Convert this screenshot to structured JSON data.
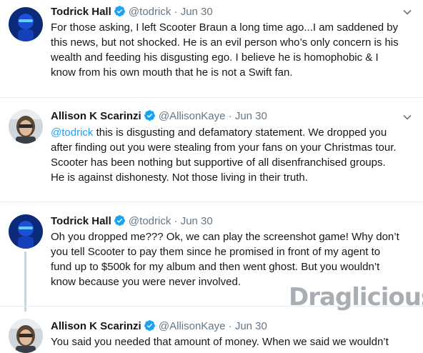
{
  "tweets": [
    {
      "name": "Todrick Hall",
      "handle": "@todrick",
      "separator": "·",
      "date": "Jun 30",
      "lines": [
        "For those asking, I left Scooter Braun a long time ago...I am saddened by",
        "this news, but not shocked. He is an evil person who’s only concern is his",
        "wealth and feeding his disgusting ego. I believe he is homophobic & I",
        "know from his own mouth that he is not a Swift fan."
      ]
    },
    {
      "name": "Allison K Scarinzi",
      "handle": "@AllisonKaye",
      "separator": "·",
      "date": "Jun 30",
      "mention": "@todrick",
      "line1_rest": " this is disgusting and defamatory statement. We dropped you",
      "lines": [
        "after finding out you were stealing from your fans on your Christmas tour.",
        "Scooter has been nothing but supportive of all disenfranchised groups.",
        "He is against dishonesty. Not those living in their truth."
      ]
    },
    {
      "name": "Todrick Hall",
      "handle": "@todrick",
      "separator": "·",
      "date": "Jun 30",
      "lines": [
        "Oh you dropped me??? Ok, we can play the screenshot game! Why don’t",
        "you tell Scooter to pay them since he promised in front of my agent to",
        "fund up to $500k for my album and then went ghost. But you wouldn’t",
        "know because you were never involved."
      ]
    },
    {
      "name": "Allison K Scarinzi",
      "handle": "@AllisonKaye",
      "separator": "·",
      "date": "Jun 30",
      "lines": [
        "You said you needed that amount of money. When we said we wouldn’t"
      ]
    }
  ],
  "watermark": "Draglicious",
  "colors": {
    "link": "#1da1f2",
    "muted": "#657786",
    "verified": "#1da1f2"
  },
  "icons": {
    "verified": "verified-badge-icon",
    "menu": "chevron-down-icon"
  }
}
